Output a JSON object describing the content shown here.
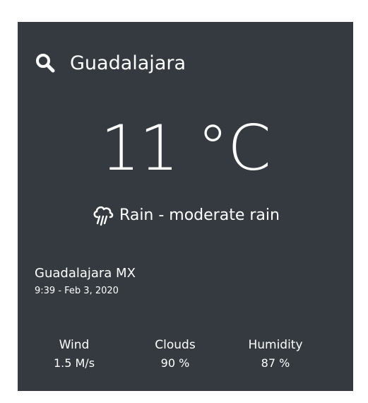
{
  "search": {
    "value": "Guadalajara",
    "icon": "search-icon"
  },
  "weather": {
    "temperature": "11 °C",
    "condition": "Rain - moderate rain",
    "condition_icon": "rain-cloud-icon"
  },
  "location": {
    "name": "Guadalajara MX",
    "datetime": "9:39 - Feb 3, 2020"
  },
  "stats": [
    {
      "label": "Wind",
      "value": "1.5 M/s"
    },
    {
      "label": "Clouds",
      "value": "90 %"
    },
    {
      "label": "Humidity",
      "value": "87 %"
    }
  ],
  "colors": {
    "card_background": "#343a40",
    "text": "#ffffff"
  }
}
